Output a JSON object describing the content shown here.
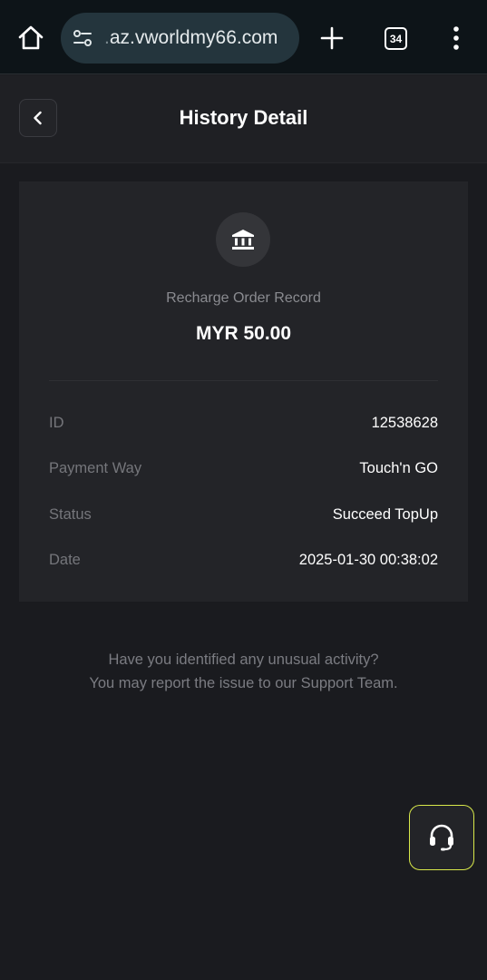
{
  "browser": {
    "url_prefix": ".",
    "url": "az.vworldmy66.com",
    "tab_count": "34"
  },
  "header": {
    "title": "History Detail"
  },
  "card": {
    "record_type": "Recharge Order Record",
    "amount": "MYR 50.00",
    "rows": [
      {
        "label": "ID",
        "value": "12538628"
      },
      {
        "label": "Payment Way",
        "value": "Touch'n GO"
      },
      {
        "label": "Status",
        "value": "Succeed TopUp"
      },
      {
        "label": "Date",
        "value": "2025-01-30 00:38:02"
      }
    ]
  },
  "notice": {
    "line1": "Have you identified any unusual activity?",
    "line2": "You may report the issue to our Support Team."
  },
  "colors": {
    "background": "#1a1b1f",
    "card": "#232428",
    "support_border": "#d8e84a"
  },
  "icons": {
    "home": "home-icon",
    "site_settings": "tune-icon",
    "new_tab": "plus-icon",
    "menu": "more-vert-icon",
    "back": "chevron-left-icon",
    "bank": "bank-icon",
    "support": "headset-icon"
  }
}
